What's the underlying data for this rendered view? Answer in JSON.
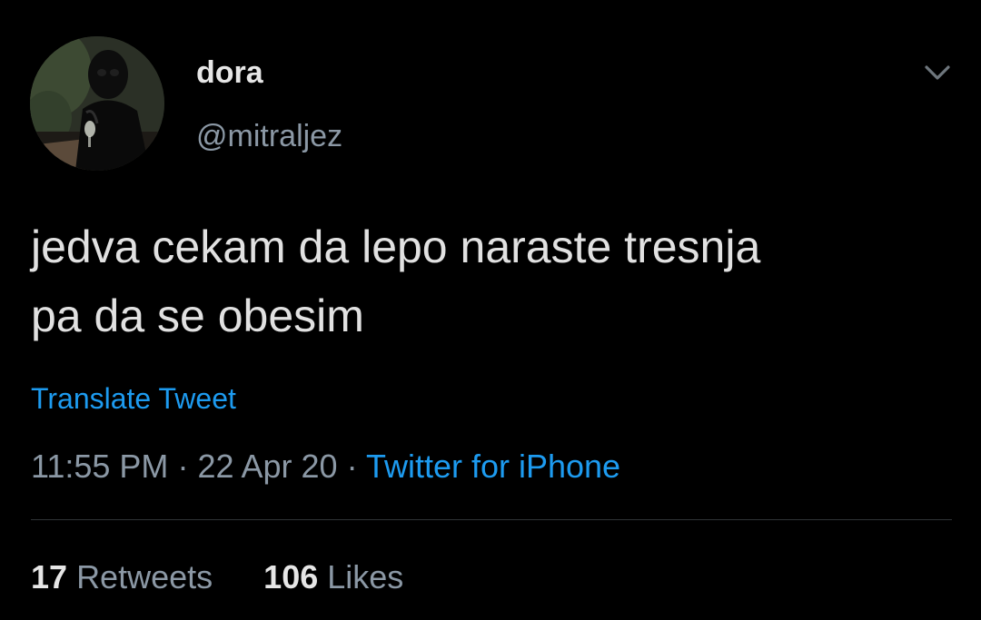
{
  "user": {
    "display_name": "dora",
    "handle": "@mitraljez"
  },
  "tweet": {
    "line1": "jedva cekam da lepo naraste tresnja",
    "line2": "pa da se obesim",
    "translate_label": "Translate Tweet",
    "time": "11:55 PM",
    "date": "22 Apr 20",
    "separator": "·",
    "source": "Twitter for iPhone"
  },
  "stats": {
    "retweets_count": "17",
    "retweets_label": "Retweets",
    "likes_count": "106",
    "likes_label": "Likes"
  },
  "icons": {
    "menu": "chevron-down-icon",
    "avatar": "avatar"
  },
  "colors": {
    "background": "#000000",
    "link": "#1d9bf0",
    "secondary_text": "#8b98a5",
    "primary_text": "#e1e1e1"
  }
}
